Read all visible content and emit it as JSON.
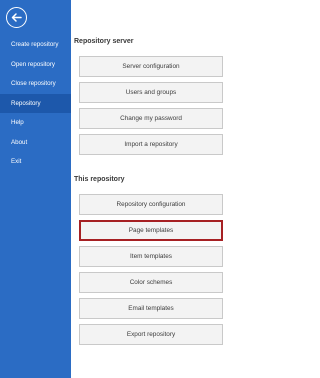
{
  "sidebar": {
    "back_icon": "arrow-left-circle-icon",
    "items": [
      {
        "label": "Create repository",
        "active": false
      },
      {
        "label": "Open repository",
        "active": false
      },
      {
        "label": "Close repository",
        "active": false
      },
      {
        "label": "Repository",
        "active": true
      },
      {
        "label": "Help",
        "active": false
      },
      {
        "label": "About",
        "active": false
      },
      {
        "label": "Exit",
        "active": false
      }
    ]
  },
  "repository_server": {
    "title": "Repository server",
    "buttons": [
      {
        "label": "Server configuration"
      },
      {
        "label": "Users and groups"
      },
      {
        "label": "Change my password"
      },
      {
        "label": "Import a repository"
      }
    ]
  },
  "this_repository": {
    "title": "This repository",
    "buttons": [
      {
        "label": "Repository configuration"
      },
      {
        "label": "Page templates",
        "selected": true
      },
      {
        "label": "Item templates"
      },
      {
        "label": "Color schemes"
      },
      {
        "label": "Email templates"
      },
      {
        "label": "Export repository"
      }
    ]
  },
  "colors": {
    "sidebar_bg": "#2b6cc4",
    "sidebar_active_bg": "#1d58ab",
    "selected_border": "#a62023"
  }
}
